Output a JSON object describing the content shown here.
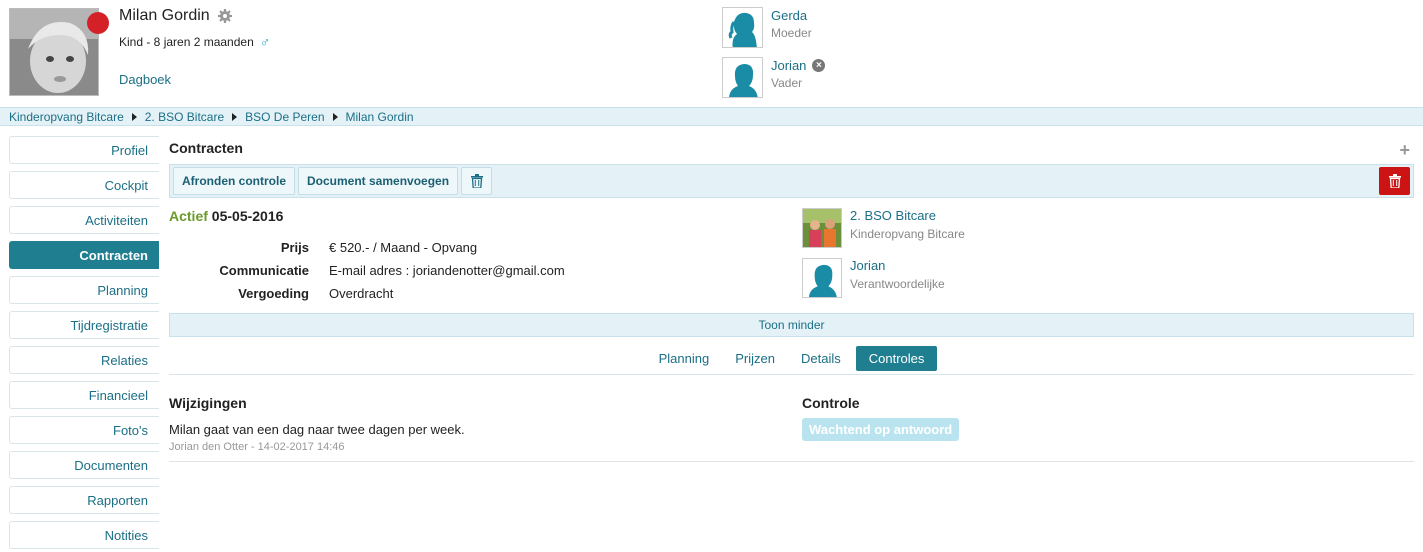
{
  "child": {
    "name": "Milan Gordin",
    "subtitle": "Kind - 8 jaren 2 maanden",
    "gender_icon": "male-icon",
    "diary_link": "Dagboek",
    "status_color": "#d42027"
  },
  "parents": [
    {
      "name": "Gerda",
      "role": "Moeder"
    },
    {
      "name": "Jorian",
      "role": "Vader"
    }
  ],
  "breadcrumb": [
    "Kinderopvang Bitcare",
    "2. BSO Bitcare",
    "BSO De Peren",
    "Milan Gordin"
  ],
  "sidebar": {
    "items": [
      {
        "label": "Profiel"
      },
      {
        "label": "Cockpit"
      },
      {
        "label": "Activiteiten"
      },
      {
        "label": "Contracten",
        "active": true
      },
      {
        "label": "Planning"
      },
      {
        "label": "Tijdregistratie"
      },
      {
        "label": "Relaties"
      },
      {
        "label": "Financieel"
      },
      {
        "label": "Foto's"
      },
      {
        "label": "Documenten"
      },
      {
        "label": "Rapporten"
      },
      {
        "label": "Notities"
      }
    ]
  },
  "contract": {
    "section_title": "Contracten",
    "toolbar": {
      "finish_check": "Afronden controle",
      "merge_document": "Document samenvoegen"
    },
    "status": "Actief",
    "date": "05-05-2016",
    "fields": [
      {
        "label": "Prijs",
        "value": "€ 520.- / Maand - Opvang"
      },
      {
        "label": "Communicatie",
        "value": "E-mail adres : joriandenotter@gmail.com"
      },
      {
        "label": "Vergoeding",
        "value": "Overdracht"
      }
    ],
    "location": {
      "name": "2. BSO Bitcare",
      "sub": "Kinderopvang Bitcare"
    },
    "responsible": {
      "name": "Jorian",
      "sub": "Verantwoordelijke"
    },
    "toggle_label": "Toon minder",
    "tabs": [
      {
        "label": "Planning"
      },
      {
        "label": "Prijzen"
      },
      {
        "label": "Details"
      },
      {
        "label": "Controles",
        "active": true
      }
    ],
    "changes_title": "Wijzigingen",
    "control_title": "Controle",
    "change_text": "Milan gaat van een dag naar twee dagen per week.",
    "change_meta": "Jorian den Otter - 14-02-2017 14:46",
    "control_status": "Wachtend op antwoord"
  },
  "colors": {
    "accent": "#1f7f91",
    "link": "#1b6f86",
    "active_status": "#6a9a2a",
    "delete": "#cc1414"
  }
}
